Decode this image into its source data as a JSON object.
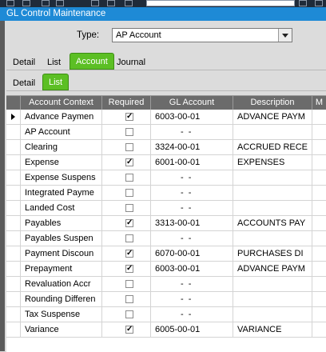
{
  "window": {
    "title": "GL Control Maintenance"
  },
  "type_field": {
    "label": "Type:",
    "value": "AP Account"
  },
  "tabs_top": [
    {
      "label": "Detail",
      "active": false
    },
    {
      "label": "List",
      "active": false
    },
    {
      "label": "Account",
      "active": true
    },
    {
      "label": "Journal",
      "active": false
    }
  ],
  "tabs_sub": [
    {
      "label": "Detail",
      "active": false
    },
    {
      "label": "List",
      "active": true
    }
  ],
  "grid": {
    "columns": [
      "Account Context",
      "Required",
      "GL Account",
      "Description",
      "M"
    ],
    "rows": [
      {
        "context": "Advance Paymen",
        "required": true,
        "gl_account": "6003-00-01",
        "description": "ADVANCE PAYM",
        "current": true
      },
      {
        "context": "AP Account",
        "required": false,
        "gl_account": "-  -",
        "description": ""
      },
      {
        "context": "Clearing",
        "required": false,
        "gl_account": "3324-00-01",
        "description": "ACCRUED RECE"
      },
      {
        "context": "Expense",
        "required": true,
        "gl_account": "6001-00-01",
        "description": "EXPENSES"
      },
      {
        "context": "Expense Suspens",
        "required": false,
        "gl_account": "-  -",
        "description": ""
      },
      {
        "context": "Integrated Payme",
        "required": false,
        "gl_account": "-  -",
        "description": ""
      },
      {
        "context": "Landed Cost",
        "required": false,
        "gl_account": "-  -",
        "description": ""
      },
      {
        "context": "Payables",
        "required": true,
        "gl_account": "3313-00-01",
        "description": "ACCOUNTS PAY"
      },
      {
        "context": "Payables Suspen",
        "required": false,
        "gl_account": "-  -",
        "description": ""
      },
      {
        "context": "Payment Discoun",
        "required": true,
        "gl_account": "6070-00-01",
        "description": "PURCHASES DI"
      },
      {
        "context": "Prepayment",
        "required": true,
        "gl_account": "6003-00-01",
        "description": "ADVANCE PAYM"
      },
      {
        "context": "Revaluation Accr",
        "required": false,
        "gl_account": "-  -",
        "description": ""
      },
      {
        "context": "Rounding Differen",
        "required": false,
        "gl_account": "-  -",
        "description": ""
      },
      {
        "context": "Tax Suspense",
        "required": false,
        "gl_account": "-  -",
        "description": ""
      },
      {
        "context": "Variance",
        "required": true,
        "gl_account": "6005-00-01",
        "description": "VARIANCE"
      }
    ]
  },
  "colors": {
    "title_bar": "#1e8ad6",
    "active_tab": "#5cbf24",
    "grid_header": "#6b6b6b"
  }
}
